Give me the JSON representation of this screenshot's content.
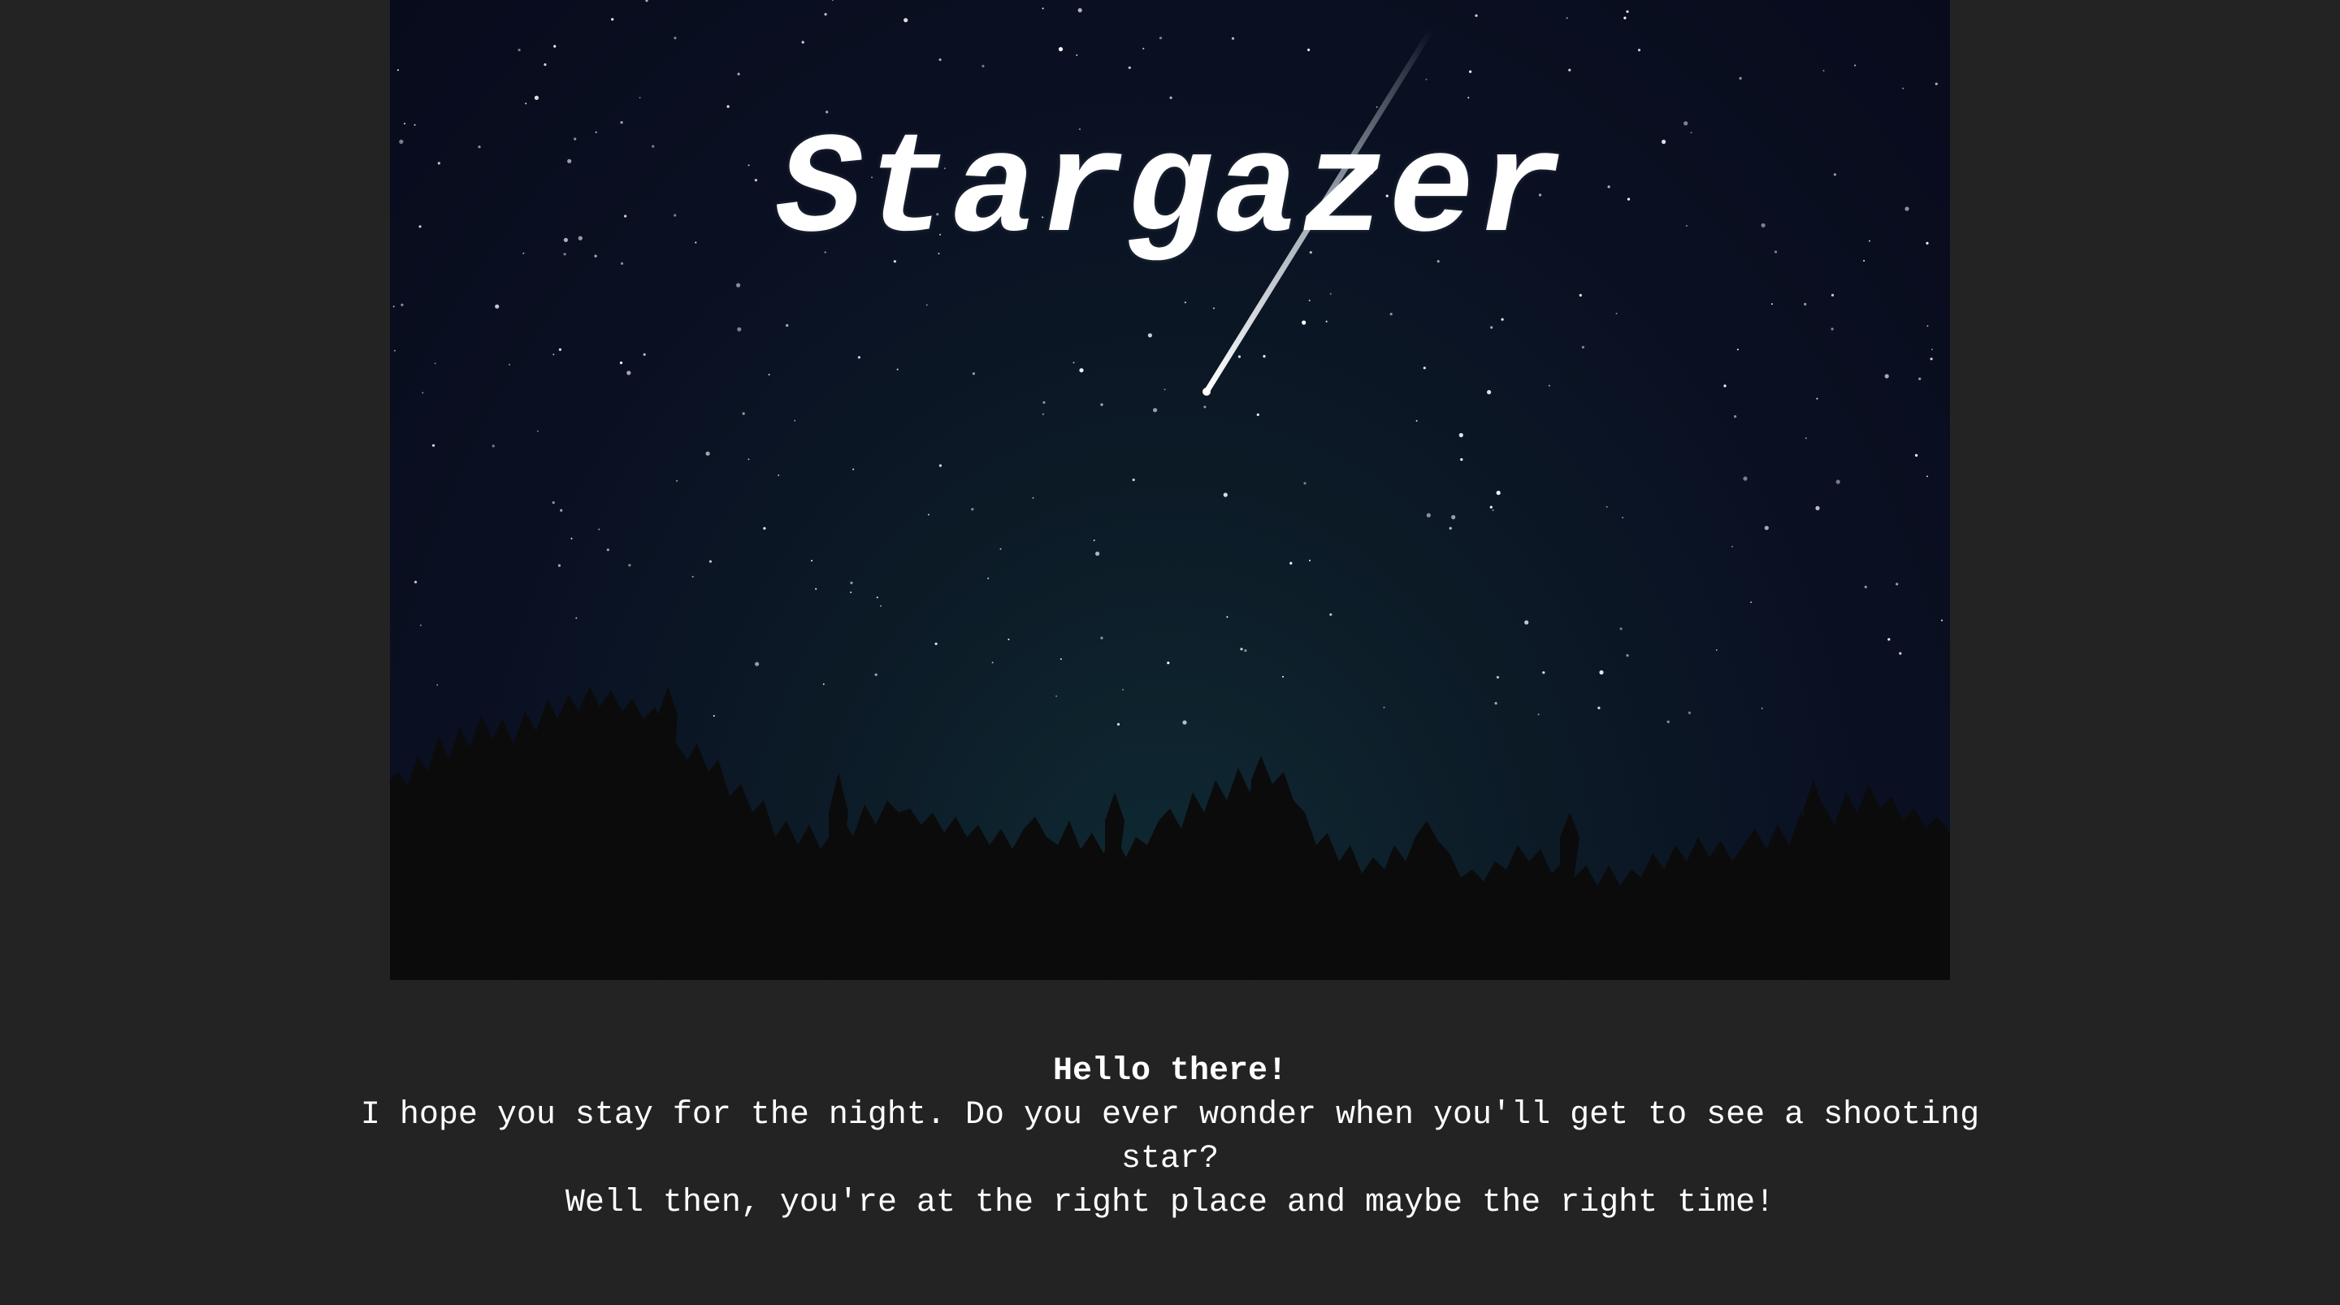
{
  "hero": {
    "title": "Stargazer",
    "colors": {
      "sky_top": "#080b1c",
      "sky_horizon": "#0f2a33",
      "treeline": "#0b0b0b",
      "page_background": "#232323"
    }
  },
  "intro": {
    "greeting": "Hello there!",
    "line1": "I hope you stay for the night. Do you ever wonder when you'll get to see a shooting star?",
    "line2": "Well then, you're at the right place and maybe the right time!"
  }
}
